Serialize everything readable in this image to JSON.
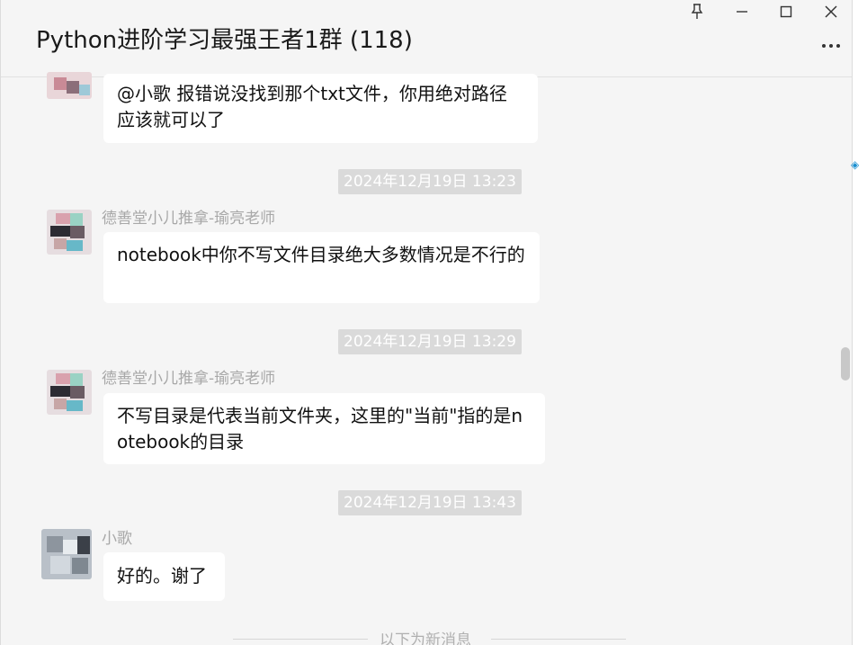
{
  "window": {
    "title": "Python进阶学习最强王者1群 (118)",
    "controls": [
      "pin-icon",
      "minimize-icon",
      "maximize-icon",
      "close-icon"
    ],
    "more_icon": "more-icon"
  },
  "messages": [
    {
      "sender": "",
      "text": "@小歌 报错说没找到那个txt文件，你用绝对路径应该就可以了"
    },
    {
      "time": "2024年12月19日 13:23",
      "sender": "德善堂小儿推拿-瑜亮老师",
      "text": "notebook中你不写文件目录绝大多数情况是不行的"
    },
    {
      "time": "2024年12月19日 13:29",
      "sender": "德善堂小儿推拿-瑜亮老师",
      "text": "不写目录是代表当前文件夹，这里的\"当前\"指的是notebook的目录"
    },
    {
      "time": "2024年12月19日 13:43",
      "sender": "小歌",
      "text": "好的。谢了"
    }
  ],
  "divider": {
    "text": "以下为新消息"
  },
  "colors": {
    "background": "#f5f5f5",
    "bubble": "#ffffff",
    "time_badge": "#dadada",
    "sender_text": "#a8a8a8"
  }
}
